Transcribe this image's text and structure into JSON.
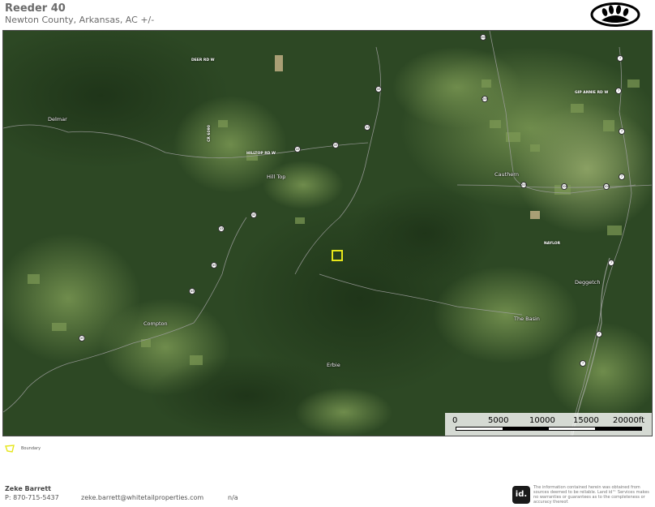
{
  "header": {
    "title": "Reeder 40",
    "subtitle": "Newton County, Arkansas,  AC +/-",
    "logo_icon": "bear-paw-icon"
  },
  "map": {
    "place_labels": {
      "delmar": "Delmar",
      "hilltop": "Hill Top",
      "compton": "Compton",
      "erbie": "Erbie",
      "cauthern": "Cauthern",
      "deggetch": "Deggetch",
      "the_basin": "The Basin"
    },
    "road_labels": {
      "deer_rd": "DEER RD W",
      "hilltop_rd": "HILLTOP RD W",
      "vertical_rd": "CR 6090",
      "naylor": "NAYLOR",
      "gip_annie": "GIP ANNIE RD W"
    },
    "highway_shields": [
      "43",
      "43",
      "43",
      "43",
      "43",
      "43",
      "43",
      "43",
      "43",
      "7",
      "7",
      "7",
      "7",
      "7",
      "7",
      "7",
      "206",
      "206",
      "206",
      "206",
      "206"
    ],
    "scale_bar": {
      "ticks": [
        "0",
        "5000",
        "10000",
        "15000",
        "20000ft"
      ]
    },
    "colors": {
      "boundary": "#e6e61a"
    }
  },
  "legend": {
    "label": "Boundary",
    "icon": "boundary-polygon-icon"
  },
  "footer": {
    "agent_name": "Zeke Barrett",
    "phone": "P: 870-715-5437",
    "email": "zeke.barrett@whitetailproperties.com",
    "na": "n/a",
    "id_badge": "id.",
    "disclaimer": "The information contained herein was obtained from sources deemed to be reliable. Land id™ Services makes no warranties or guarantees as to the completeness or accuracy thereof."
  }
}
